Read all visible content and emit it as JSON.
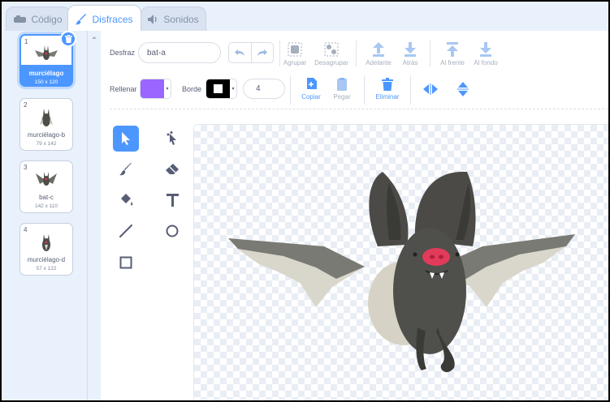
{
  "tabs": [
    {
      "label": "Código",
      "icon": "code-icon"
    },
    {
      "label": "Disfraces",
      "icon": "brush-icon"
    },
    {
      "label": "Sonidos",
      "icon": "speaker-icon"
    }
  ],
  "costumes": [
    {
      "number": "1",
      "name": "murciélago",
      "size": "150 x 120"
    },
    {
      "number": "2",
      "name": "murciélago-b",
      "size": "79 x 142"
    },
    {
      "number": "3",
      "name": "bat-c",
      "size": "142 x 110"
    },
    {
      "number": "4",
      "name": "murciélago-d",
      "size": "57 x 122"
    }
  ],
  "toolbar": {
    "costume_label": "Desfraz",
    "costume_name": "bat-a",
    "group": "Agrupar",
    "ungroup": "Desagrupar",
    "forward": "Adelante",
    "backward": "Atrás",
    "front": "Al frente",
    "back": "Al fondo",
    "fill_label": "Rellenar",
    "outline_label": "Borde",
    "outline_width": "4",
    "copy": "Copiar",
    "paste": "Pegar",
    "delete": "Eliminar"
  },
  "colors": {
    "accent": "#4c97ff",
    "fill": "#9966ff",
    "outline": "#000000",
    "delete": "#4c97ff"
  }
}
